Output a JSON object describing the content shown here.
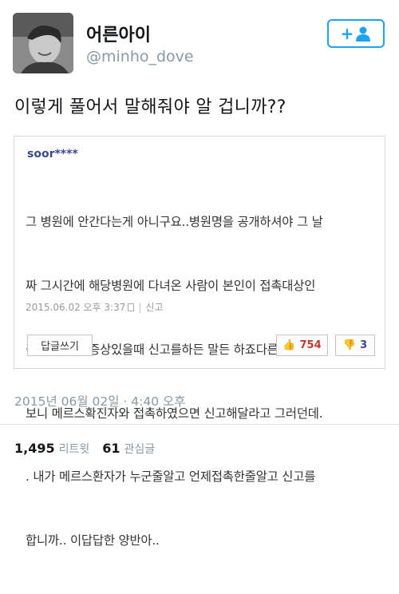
{
  "user": {
    "display_name": "어른아이",
    "handle": "@minho_dove"
  },
  "follow_button": {
    "icon": "add-user-icon",
    "symbol": "+"
  },
  "tweet": {
    "text": "이렇게 풀어서 말해줘야 알 겁니까??"
  },
  "comment": {
    "username": "soor****",
    "lines": [
      "그 병원에 안간다는게 아니구요..병원명을 공개하셔야 그 날",
      "짜 그시간에 해당병원에 다녀온 사람이 본인이 접촉대상인",
      "걸 알고 의심증상있을때 신고를하든 말든 하죠다른 기사에",
      "보니 메르스확진자와 접촉하였으면 신고해달라고 그러던데.",
      ". 내가 메르스환자가 누군줄알고 언제접촉한줄알고 신고를",
      "합니까.. 이답답한 양반아.."
    ],
    "date": "2015.06.02 오후 3:37",
    "report_label": "신고",
    "reply_label": "답글쓰기",
    "likes": "754",
    "dislikes": "3"
  },
  "timestamp": "2015년 06월 02일 · 4:40 오후",
  "stats": {
    "retweets": "1,495",
    "retweets_label": "리트윗",
    "likes": "61",
    "likes_label": "관심글"
  },
  "colors": {
    "accent": "#1da1f2",
    "muted": "#8899a6",
    "username": "#3a4a8c",
    "like_count": "#c0392b"
  }
}
